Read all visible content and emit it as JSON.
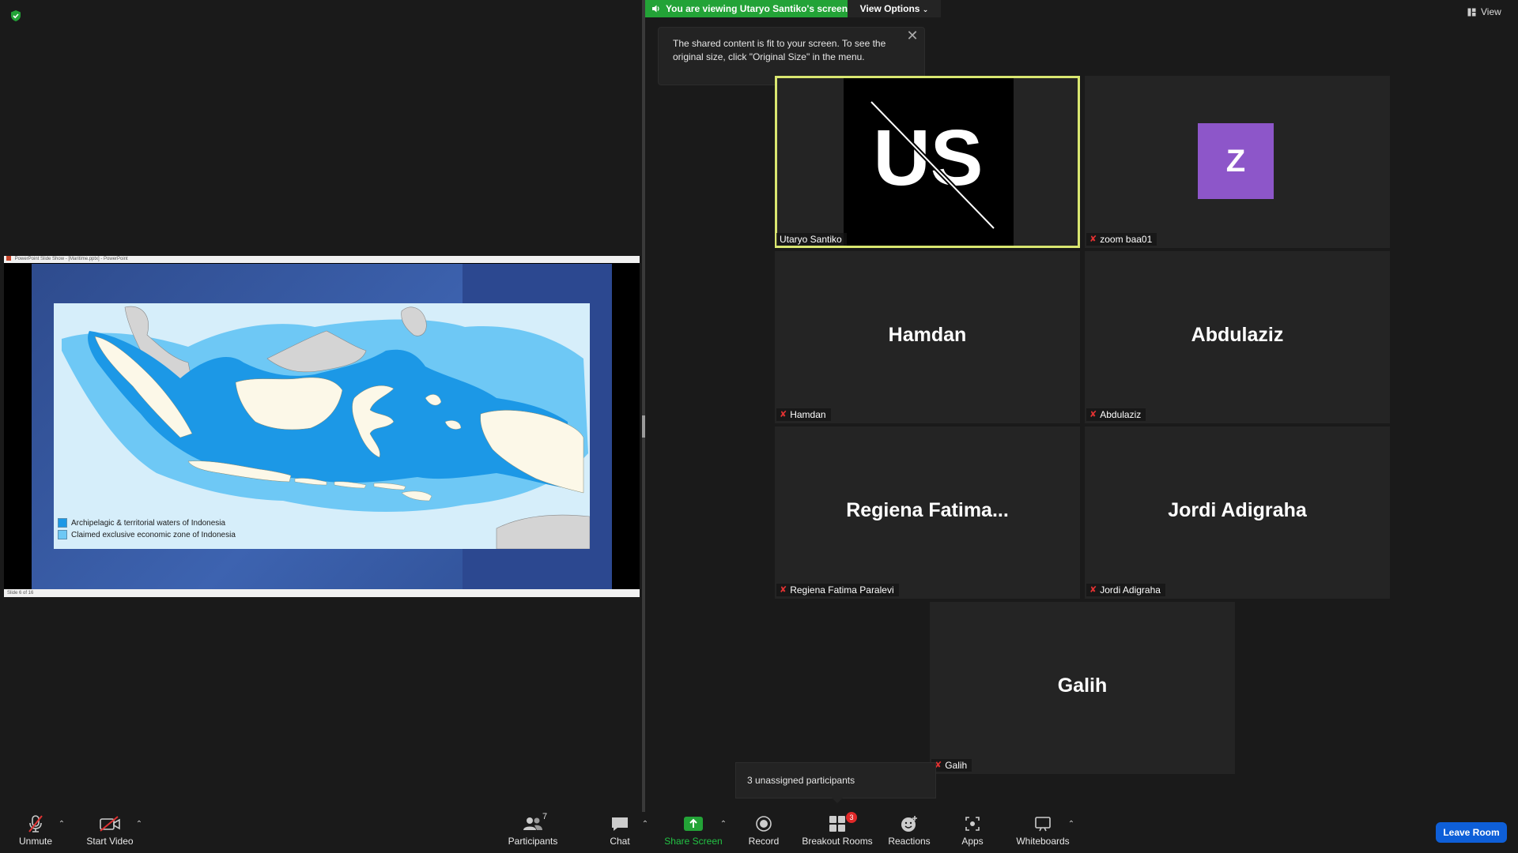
{
  "top": {
    "viewing_banner": "You are viewing Utaryo Santiko's screen",
    "view_options": "View Options",
    "view_button": "View",
    "toast_text": "The shared content is fit to your screen. To see the original size, click \"Original Size\" in the menu."
  },
  "share": {
    "window_title": "PowerPoint Slide Show - [Maritime.pptx] - PowerPoint",
    "status_left": "Slide 6 of 16",
    "legend": [
      {
        "label": "Archipelagic & territorial waters of Indonesia",
        "color": "#1c98e6"
      },
      {
        "label": "Claimed exclusive economic zone of Indonesia",
        "color": "#6ec8f5"
      }
    ]
  },
  "participants": [
    {
      "label": "Utaryo Santiko",
      "big": "US",
      "muted": false,
      "active": true
    },
    {
      "label": "zoom baa01",
      "big": "Z",
      "muted": true
    },
    {
      "label": "Hamdan",
      "big": "Hamdan",
      "muted": true
    },
    {
      "label": "Abdulaziz",
      "big": "Abdulaziz",
      "muted": true
    },
    {
      "label": "Regiena Fatima Paralevi",
      "big": "Regiena  Fatima...",
      "muted": true
    },
    {
      "label": "Jordi Adigraha",
      "big": "Jordi Adigraha",
      "muted": true
    },
    {
      "label": "Galih",
      "big": "Galih",
      "muted": true
    }
  ],
  "popup": {
    "unassigned": "3 unassigned participants"
  },
  "toolbar": {
    "unmute": "Unmute",
    "start_video": "Start Video",
    "participants": "Participants",
    "participants_count": "7",
    "chat": "Chat",
    "share_screen": "Share Screen",
    "record": "Record",
    "breakout_rooms": "Breakout Rooms",
    "breakout_badge": "3",
    "reactions": "Reactions",
    "apps": "Apps",
    "whiteboards": "Whiteboards",
    "leave_room": "Leave Room"
  },
  "colors": {
    "share_green": "#23a337",
    "active_speaker": "#d9e670",
    "leave_blue": "#0e5fd8",
    "avatar_purple": "#8d56c9",
    "muted_red": "#e03232"
  }
}
